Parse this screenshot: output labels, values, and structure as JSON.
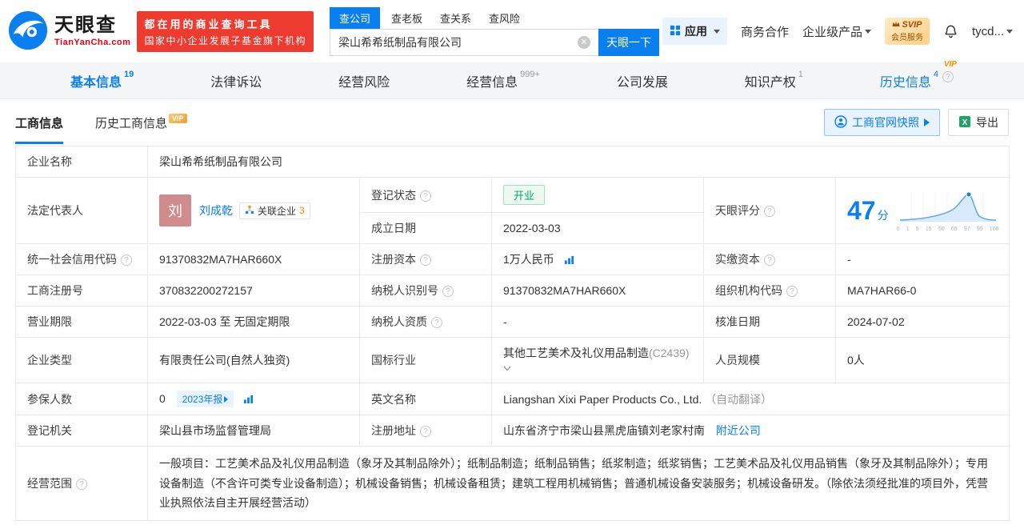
{
  "colors": {
    "brand_blue": "#0a7ff0",
    "promo_red": "#ee3b30",
    "vip_orange": "#ff8a00",
    "status_green": "#00a870"
  },
  "header": {
    "logo_cn": "天眼查",
    "logo_en": "TianYanCha.com",
    "promo_line1": "都在用的商业查询工具",
    "promo_line2": "国家中小企业发展子基金旗下机构",
    "search_tabs": [
      {
        "label": "查公司"
      },
      {
        "label": "查老板"
      },
      {
        "label": "查关系"
      },
      {
        "label": "查风险"
      }
    ],
    "search_value": "梁山希希纸制品有限公司",
    "search_button": "天眼一下",
    "apps_label": "应用",
    "biz_coop": "商务合作",
    "enterprise_product": "企业级产品",
    "svip_line1": "SVIP",
    "svip_line2": "会员服务",
    "username": "tycd..."
  },
  "nav_tabs": [
    {
      "label": "基本信息",
      "count": "19"
    },
    {
      "label": "法律诉讼",
      "count": ""
    },
    {
      "label": "经营风险",
      "count": ""
    },
    {
      "label": "经营信息",
      "count": "999+"
    },
    {
      "label": "公司发展",
      "count": ""
    },
    {
      "label": "知识产权",
      "count": "1"
    },
    {
      "label": "历史信息",
      "count": "4",
      "vip": "VIP"
    }
  ],
  "sub_tabs": {
    "business_info": "工商信息",
    "history_business_info": "历史工商信息",
    "vip_tag": "VIP"
  },
  "actions": {
    "snapshot": "工商官网快照",
    "export": "导出"
  },
  "fields": {
    "name": "企业名称",
    "legal_rep": "法定代表人",
    "reg_status": "登记状态",
    "est_date": "成立日期",
    "score": "天眼评分",
    "credit_code": "统一社会信用代码",
    "reg_capital": "注册资本",
    "paid_capital": "实缴资本",
    "reg_number": "工商注册号",
    "taxpayer_id": "纳税人识别号",
    "org_code": "组织机构代码",
    "business_term": "营业期限",
    "taxpayer_quality": "纳税人资质",
    "approval_date": "核准日期",
    "company_type": "企业类型",
    "industry": "国标行业",
    "staff_size": "人员规模",
    "insured_count": "参保人数",
    "english_name": "英文名称",
    "reg_authority": "登记机关",
    "reg_address": "注册地址",
    "business_scope": "经营范围"
  },
  "values": {
    "name": "梁山希希纸制品有限公司",
    "legal_rep_avatar": "刘",
    "legal_rep_name": "刘成乾",
    "related_label": "关联企业",
    "related_count": "3",
    "reg_status": "开业",
    "est_date": "2022-03-03",
    "credit_code": "91370832MA7HAR660X",
    "reg_capital": "1万人民币",
    "paid_capital": "-",
    "reg_number": "370832200272157",
    "taxpayer_id": "91370832MA7HAR660X",
    "org_code": "MA7HAR66-0",
    "business_term": "2022-03-03 至 无固定期限",
    "taxpayer_quality": "-",
    "approval_date": "2024-07-02",
    "company_type": "有限责任公司(自然人独资)",
    "industry_name": "其他工艺美术及礼仪用品制造",
    "industry_code": "(C2439)",
    "staff_size": "0人",
    "insured_count": "0",
    "annual_report": "2023年报",
    "english_name": "Liangshan Xixi Paper Products Co., Ltd.",
    "auto_translate": "（自动翻译）",
    "reg_authority": "梁山县市场监督管理局",
    "reg_address": "山东省济宁市梁山县黑虎庙镇刘老家村南",
    "nearby_link": "附近公司",
    "business_scope": "一般项目：工艺美术品及礼仪用品制造（象牙及其制品除外）；纸制品制造；纸制品销售；纸浆制造；纸浆销售；工艺美术品及礼仪用品销售（象牙及其制品除外）；专用设备制造（不含许可类专业设备制造）；机械设备销售；机械设备租赁；建筑工程用机械销售；普通机械设备安装服务；机械设备研发。（除依法须经批准的项目外，凭营业执照依法自主开展经营活动）"
  },
  "score": {
    "value": "47",
    "unit": "分",
    "axis": [
      "0",
      "1",
      "5",
      "15",
      "50",
      "65",
      "97",
      "99",
      "100"
    ]
  }
}
